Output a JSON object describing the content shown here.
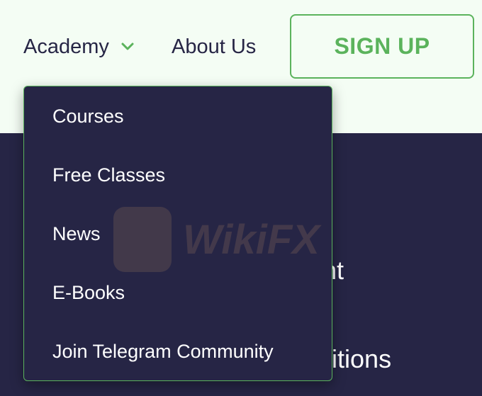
{
  "nav": {
    "academy_label": "Academy",
    "about_label": "About Us",
    "signup_label": "SIGN UP",
    "chevron_icon": "chevron-down-icon"
  },
  "dropdown": {
    "items": [
      {
        "label": "Courses"
      },
      {
        "label": "Free Classes"
      },
      {
        "label": "News"
      },
      {
        "label": "E-Books"
      },
      {
        "label": "Join Telegram Community"
      }
    ]
  },
  "background": {
    "line1_fragment": "nt",
    "line2_fragment": "ditions"
  },
  "watermark": {
    "text": "WikiFX"
  },
  "colors": {
    "accent": "#5bb35c",
    "dark": "#262545",
    "light_bg": "#f4fdf4"
  }
}
